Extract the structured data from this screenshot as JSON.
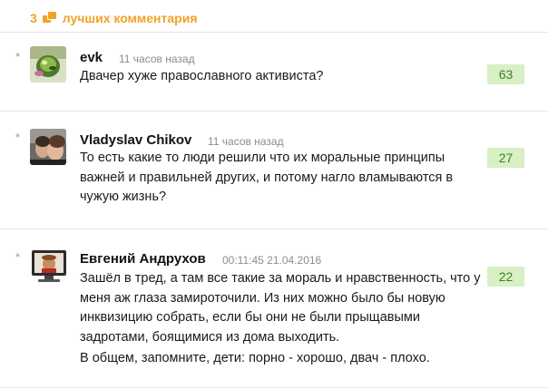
{
  "header": {
    "count": "3",
    "label": "лучших комментария"
  },
  "comments": [
    {
      "author": "evk",
      "time": "11 часов назад",
      "text": [
        "Двачер хуже православного активиста?"
      ],
      "score": "63"
    },
    {
      "author": "Vladyslav Chikov",
      "time": "11 часов назад",
      "text": [
        "То есть какие то люди решили что их моральные принципы",
        "важней и правильней других, и потому нагло вламываются в",
        "чужую жизнь?"
      ],
      "score": "27"
    },
    {
      "author": "Евгений Андрухов",
      "time": "00:11:45 21.04.2016",
      "text": [
        "Зашёл в тред, а там все такие за мораль и нравственность, что у",
        "меня аж глаза замироточили. Из них можно было бы новую",
        "инквизицию собрать, если бы они не были прыщавыми",
        "задротами, боящимися из дома выходить."
      ],
      "text2": "В общем, запомните, дети: порно - хорошо, двач - плохо.",
      "score": "22"
    }
  ],
  "colors": {
    "accent": "#f2a229",
    "score_bg": "#d8f0c4",
    "score_text": "#3e7d2a",
    "time_text": "#8c8c8c",
    "separator": "#e6e6e6"
  },
  "icons": {
    "header": "comments-icon",
    "rate": "star-icon"
  }
}
